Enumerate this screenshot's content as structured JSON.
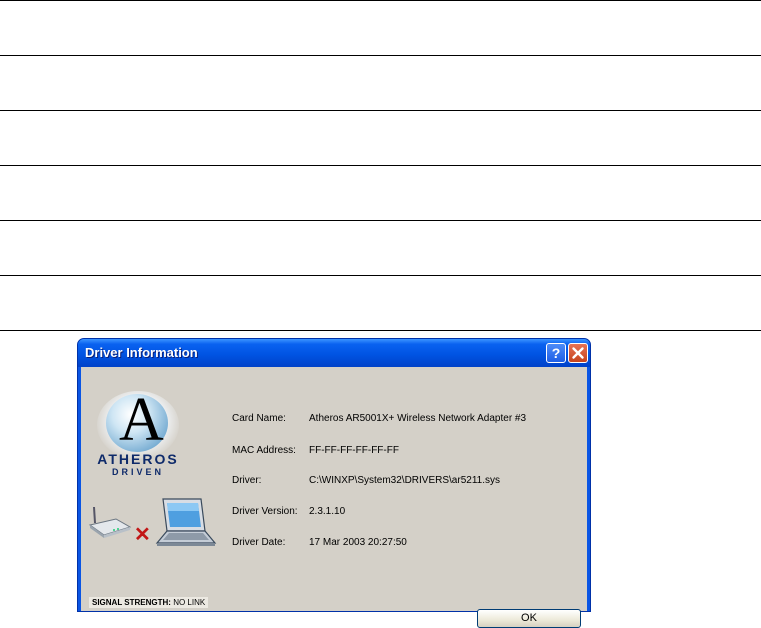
{
  "dialog": {
    "title": "Driver Information",
    "help_label": "?",
    "close_label": "✕",
    "brand": "ATHEROS",
    "brand_sub": "DRIVEN",
    "logo_letter": "A",
    "signal": {
      "label": "SIGNAL STRENGTH:",
      "value": "NO LINK"
    },
    "fields": [
      {
        "label": "Card Name:",
        "value": "Atheros AR5001X+ Wireless Network Adapter #3"
      },
      {
        "label": "MAC Address:",
        "value": "FF-FF-FF-FF-FF-FF"
      },
      {
        "label": "Driver:",
        "value": "C:\\WINXP\\System32\\DRIVERS\\ar5211.sys"
      },
      {
        "label": "Driver Version:",
        "value": "2.3.1.10"
      },
      {
        "label": "Driver Date:",
        "value": "17 Mar 2003 20:27:50"
      }
    ],
    "ok_label": "OK",
    "no_link_mark": "✕",
    "colors": {
      "titlebar": "#0054e3",
      "client_bg": "#d4d0c8",
      "close_button": "#c6431d",
      "no_link_x": "#c21616"
    }
  }
}
